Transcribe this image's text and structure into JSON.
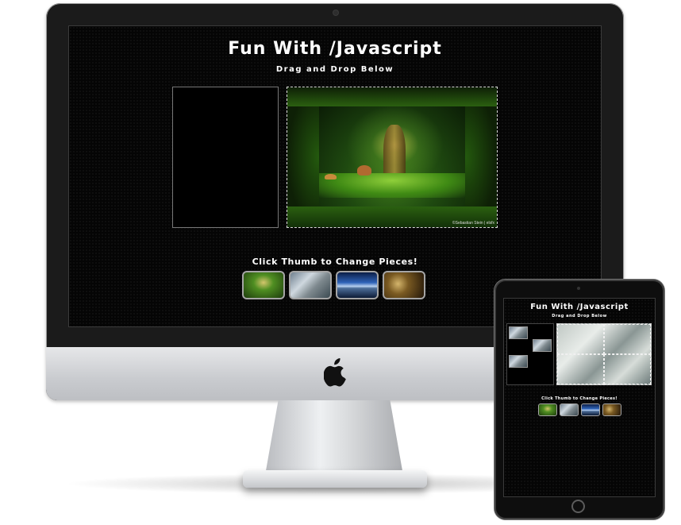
{
  "imac": {
    "title": "Fun With /Javascript",
    "subtitle": "Drag and Drop Below",
    "thumb_label": "Click Thumb to Change Pieces!",
    "credit": "©Sebastian Stein | elsfx"
  },
  "ipad": {
    "title": "Fun With /Javascript",
    "subtitle": "Drag and Drop Below",
    "thumb_label": "Click Thumb to Change Pieces!"
  },
  "thumbnails": [
    "forest-thumb",
    "city-thumb",
    "space-thumb",
    "gold-thumb"
  ],
  "colors": {
    "screen_bg": "#050505",
    "text": "#ffffff",
    "thumb_border": "#a5a5a5",
    "aluminium": "#c9cbcf"
  }
}
